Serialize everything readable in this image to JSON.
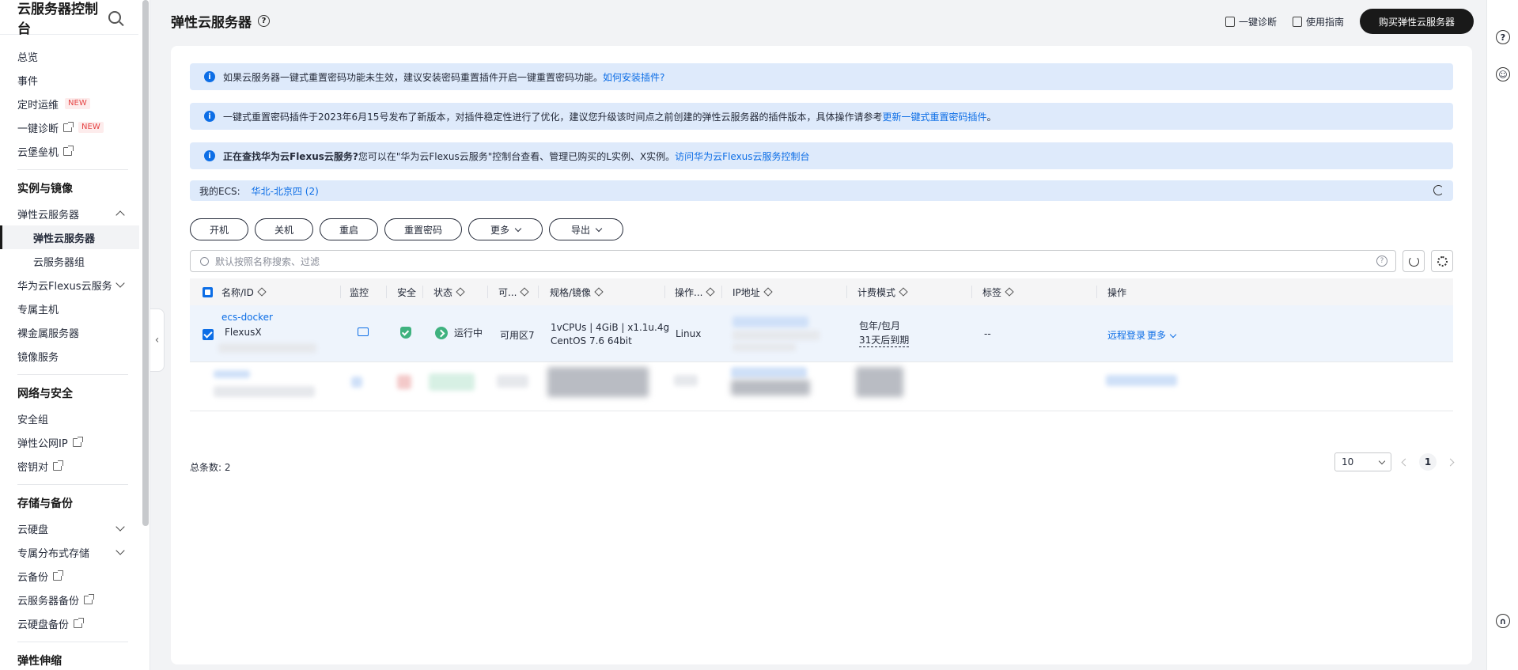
{
  "sidebar": {
    "title": "云服务器控制台",
    "items_top": [
      {
        "label": "总览"
      },
      {
        "label": "事件"
      },
      {
        "label": "定时运维",
        "badge": "NEW"
      },
      {
        "label": "一键诊断",
        "badge": "NEW",
        "external": true
      },
      {
        "label": "云堡垒机",
        "external": true
      }
    ],
    "group_instances": "实例与镜像",
    "items_instances": [
      {
        "label": "弹性云服务器"
      },
      {
        "label": "弹性云服务器"
      },
      {
        "label": "云服务器组"
      },
      {
        "label": "华为云Flexus云服务"
      },
      {
        "label": "专属主机"
      },
      {
        "label": "裸金属服务器"
      },
      {
        "label": "镜像服务"
      }
    ],
    "group_network": "网络与安全",
    "items_network": [
      {
        "label": "安全组"
      },
      {
        "label": "弹性公网IP"
      },
      {
        "label": "密钥对"
      }
    ],
    "group_storage": "存储与备份",
    "items_storage": [
      {
        "label": "云硬盘"
      },
      {
        "label": "专属分布式存储"
      },
      {
        "label": "云备份"
      },
      {
        "label": "云服务器备份"
      },
      {
        "label": "云硬盘备份"
      }
    ],
    "group_partial": "弹性伸缩"
  },
  "header": {
    "title": "弹性云服务器",
    "diagnose": "一键诊断",
    "guide": "使用指南",
    "buy": "购买弹性云服务器"
  },
  "notices": [
    {
      "text": "如果云服务器一键式重置密码功能未生效，建议安装密码重置插件开启一键重置密码功能。",
      "link": "如何安装插件?",
      "suffix": ""
    },
    {
      "text": "一键式重置密码插件于2023年6月15号发布了新版本，对插件稳定性进行了优化，建议您升级该时间点之前创建的弹性云服务器的插件版本，具体操作请参考",
      "link": "更新一键式重置密码插件",
      "suffix": "。"
    },
    {
      "bold": "正在查找华为云Flexus云服务?",
      "text": " 您可以在\"华为云Flexus云服务\"控制台查看、管理已购买的L实例、X实例。",
      "link": "访问华为云Flexus云服务控制台",
      "suffix": ""
    }
  ],
  "region": {
    "label": "我的ECS:",
    "value": "华北-北京四 (2)"
  },
  "actions": {
    "start": "开机",
    "stop": "关机",
    "restart": "重启",
    "reset_pwd": "重置密码",
    "more": "更多",
    "export": "导出"
  },
  "search": {
    "placeholder": "默认按照名称搜索、过滤"
  },
  "table": {
    "columns": {
      "name": "名称/ID",
      "monitor": "监控",
      "security": "安全",
      "status": "状态",
      "az": "可...",
      "spec": "规格/镜像",
      "os": "操作...",
      "ip": "IP地址",
      "billing": "计费模式",
      "tags": "标签",
      "ops": "操作"
    },
    "rows": [
      {
        "name": "ecs-docker",
        "tag": "FlexusX",
        "status": "运行中",
        "az": "可用区7",
        "spec_line1": "1vCPUs | 4GiB | x1.1u.4g",
        "spec_line2": "CentOS 7.6 64bit",
        "os": "Linux",
        "billing_line1": "包年/包月",
        "billing_line2": "31天后到期",
        "tags": "--",
        "op_remote": "远程登录",
        "op_more": "更多"
      }
    ]
  },
  "footer": {
    "total_label": "总条数: 2",
    "page_size": "10",
    "current_page": "1"
  },
  "colors": {
    "primary": "#0d6ee6",
    "notice_bg": "#deeafb",
    "success": "#3fb27f",
    "dark": "#191919"
  }
}
